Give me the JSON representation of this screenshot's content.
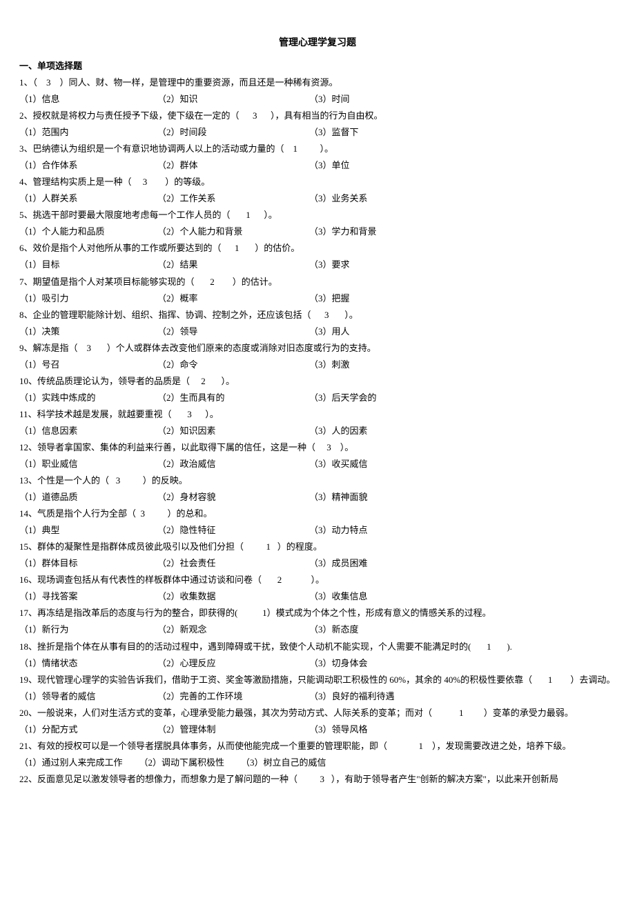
{
  "title": "管理心理学复习题",
  "section_header": "一、单项选择题",
  "questions": [
    {
      "stem": "1、（    3    ）同人、财、物一样，是管理中的重要资源，而且还是一种稀有资源。",
      "opts": [
        "（1）信息",
        "（2）知识",
        "（3）时间"
      ]
    },
    {
      "stem": "2、授权就是将权力与责任授予下级，使下级在一定的（      3      ），具有相当的行为自由权。",
      "opts": [
        "（1）范围内",
        "（2）时间段",
        "（3）监督下"
      ]
    },
    {
      "stem": "3、巴纳德认为组织是一个有意识地协调两人以上的活动或力量的（    1          ）。",
      "opts": [
        "（1）合作体系",
        "（2）群体",
        "（3）单位"
      ]
    },
    {
      "stem": "4、管理结构实质上是一种（     3        ）的等级。",
      "opts": [
        "（1）人群关系",
        "（2）工作关系",
        "（3）业务关系"
      ]
    },
    {
      "stem": "5、挑选干部时要最大限度地考虑每一个工作人员的（       1      ）。",
      "opts": [
        "（1）个人能力和品质",
        "（2）个人能力和背景",
        "（3）学力和背景"
      ]
    },
    {
      "stem": "6、效价是指个人对他所从事的工作或所要达到的（      1       ）的估价。",
      "opts": [
        "（1）目标",
        "（2）结果",
        "（3）要求"
      ]
    },
    {
      "stem": "7、期望值是指个人对某项目标能够实现的（       2        ）的估计。",
      "opts": [
        "（1）吸引力",
        "（2）概率",
        "（3）把握"
      ]
    },
    {
      "stem": "8、企业的管理职能除计划、组织、指挥、协调、控制之外，还应该包括（      3       ）。",
      "opts": [
        "（1）决策",
        "（2）领导",
        "（3）用人"
      ]
    },
    {
      "stem": "9、解冻是指（    3       ）个人或群体去改变他们原来的态度或消除对旧态度或行为的支持。",
      "opts": [
        "（1）号召",
        "（2）命令",
        "（3）刺激"
      ]
    },
    {
      "stem": "10、传统品质理论认为，领导者的品质是（     2       ）。",
      "opts": [
        "（1）实践中炼成的",
        "（2）生而具有的",
        "（3）后天学会的"
      ]
    },
    {
      "stem": "11、科学技术越是发展，就越要重视（       3      ）。",
      "opts": [
        "（1）信息因素",
        "（2）知识因素",
        "（3）人的因素"
      ]
    },
    {
      "stem": "12、领导者拿国家、集体的利益来行善，以此取得下属的信任，这是一种（     3    ）。",
      "opts": [
        "（1）职业威信",
        "（2）政治威信",
        "（3）收买威信"
      ]
    },
    {
      "stem": "13、个性是一个人的（   3          ）的反映。",
      "opts": [
        "（1）道德品质",
        "（2）身材容貌",
        "（3）精神面貌"
      ]
    },
    {
      "stem": "14、气质是指个人行为全部（  3          ）的总和。",
      "opts": [
        "（1）典型",
        "（2）隐性特征",
        "（3）动力特点"
      ]
    },
    {
      "stem": "15、群体的凝聚性是指群体成员彼此吸引以及他们分担（          1   ）的程度。",
      "opts": [
        "（1）群体目标",
        "（2）社会责任",
        "（3）成员困难"
      ]
    },
    {
      "stem": "16、现场调查包括从有代表性的样板群体中通过访谈和问卷（       2             ）。",
      "opts": [
        "（1）寻找答案",
        "（2）收集数据",
        "（3）收集信息"
      ]
    },
    {
      "stem": "17、再冻结是指改革后的态度与行为的整合，即获得的(           1）模式成为个体之个性，形成有意义的情感关系的过程。",
      "opts": [
        "（1）新行为",
        "（2）新观念",
        "（3）新态度"
      ]
    },
    {
      "stem": "18、挫折是指个体在从事有目的的活动过程中，遇到障碍或干扰，致使个人动机不能实现，个人需要不能满足时的(       1       ).",
      "opts": [
        "（1）情绪状态",
        "（2）心理反应",
        "（3）切身体会"
      ]
    },
    {
      "stem": "19、现代管理心理学的实验告诉我们，借助于工资、奖金等激励措施，只能调动职工积极性的 60%，其余的 40%的积极性要依靠（       1        ）去调动。",
      "opts": [
        "（1）领导者的威信",
        "（2）完善的工作环境",
        "（3）良好的福利待遇"
      ]
    },
    {
      "stem": "20、一般说来，人们对生活方式的变革，心理承受能力最强，其次为劳动方式、人际关系的变革；而对（            1         ）变革的承受力最弱。",
      "opts": [
        "（1）分配方式",
        "（2）管理体制",
        "（3）领导风格"
      ]
    },
    {
      "stem": "21、有效的授权可以是一个领导者摆脱具体事务，从而使他能完成一个重要的管理职能，即（              1    ），发现需要改进之处，培养下级。",
      "opts": [
        "（1）通过别人来完成工作",
        "（2）调动下属积极性",
        "（3）树立自己的威信"
      ],
      "compact_opts": true
    },
    {
      "stem": "22、反面意见足以激发领导者的想像力，而想象力是了解问题的一种（          3   ），有助于领导者产生\"创新的解决方案\"，以此来开创新局"
    }
  ]
}
